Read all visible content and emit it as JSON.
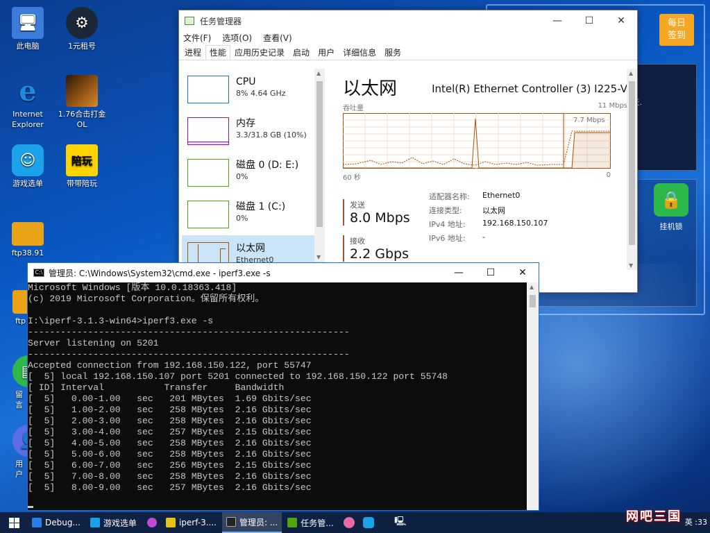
{
  "desktop": {
    "icons": [
      {
        "label": "此电脑",
        "color": "#3b7dd8"
      },
      {
        "label": "1元租号",
        "color": "#1b2838"
      },
      {
        "label": "Internet Explorer",
        "color": "#1e88e5"
      },
      {
        "label": "1.76合击打金 OL",
        "color": "#5a3510"
      },
      {
        "label": "游戏选单",
        "color": "#1aa3e8"
      },
      {
        "label": "带带陪玩",
        "color": "#ffd400"
      },
      {
        "label": "ftp38.91",
        "color": "#e8a317"
      },
      {
        "label": "ftp",
        "color": "#e8a317"
      },
      {
        "label": "留言",
        "color": "#2db84c"
      },
      {
        "label": "用户",
        "color": "#5b6ee8"
      }
    ],
    "glyphs": {
      "steam": "⚙",
      "peiwan": "陪玩"
    }
  },
  "right_panel": {
    "sign_button": "每日\n签到",
    "sign_line1": "每日",
    "sign_line2": "签到",
    "lock_label": "挂机锁",
    "panel_text_fragment": "天."
  },
  "task_manager": {
    "title": "任务管理器",
    "controls": {
      "minimize": "—",
      "maximize": "☐",
      "close": "✕"
    },
    "menu": [
      "文件(F)",
      "选项(O)",
      "查看(V)"
    ],
    "tabs": [
      "进程",
      "性能",
      "应用历史记录",
      "启动",
      "用户",
      "详细信息",
      "服务"
    ],
    "active_tab": "性能",
    "items": [
      {
        "name": "CPU",
        "value": "8% 4.64 GHz",
        "color": "#117dbb"
      },
      {
        "name": "内存",
        "value": "3.3/31.8 GB (10%)",
        "color": "#8b12ae"
      },
      {
        "name": "磁盘 0 (D: E:)",
        "value": "0%",
        "color": "#4da60c"
      },
      {
        "name": "磁盘 1 (C:)",
        "value": "0%",
        "color": "#4da60c"
      },
      {
        "name": "以太网",
        "value": "Ethernet0",
        "color": "#a74f01"
      }
    ],
    "detail": {
      "title": "以太网",
      "adapter": "Intel(R) Ethernet Controller (3) I225-V",
      "throughput_label": "吞吐量",
      "max_label": "11 Mbps",
      "inner_max_label": "7.7 Mbps",
      "time_left": "60 秒",
      "time_right": "0",
      "send_label": "发送",
      "send_value": "8.0 Mbps",
      "recv_label": "接收",
      "recv_value": "2.2 Gbps",
      "props": [
        {
          "key": "适配器名称:",
          "value": "Ethernet0"
        },
        {
          "key": "连接类型:",
          "value": "以太网"
        },
        {
          "key": "IPv4 地址:",
          "value": "192.168.150.107"
        },
        {
          "key": "IPv6 地址:",
          "value": "-"
        }
      ],
      "graph_color": "#a74f01"
    }
  },
  "cmd": {
    "title": "管理员: C:\\Windows\\System32\\cmd.exe - iperf3.exe  -s",
    "controls": {
      "minimize": "—",
      "maximize": "☐",
      "close": "✕"
    },
    "lines": [
      "Microsoft Windows [版本 10.0.18363.418]",
      "(c) 2019 Microsoft Corporation。保留所有权利。",
      "",
      "I:\\iperf-3.1.3-win64>iperf3.exe -s",
      "-----------------------------------------------------------",
      "Server listening on 5201",
      "-----------------------------------------------------------",
      "Accepted connection from 192.168.150.122, port 55747",
      "[  5] local 192.168.150.107 port 5201 connected to 192.168.150.122 port 55748",
      "[ ID] Interval           Transfer     Bandwidth",
      "[  5]   0.00-1.00   sec   201 MBytes  1.69 Gbits/sec",
      "[  5]   1.00-2.00   sec   258 MBytes  2.16 Gbits/sec",
      "[  5]   2.00-3.00   sec   258 MBytes  2.16 Gbits/sec",
      "[  5]   3.00-4.00   sec   257 MBytes  2.15 Gbits/sec",
      "[  5]   4.00-5.00   sec   258 MBytes  2.16 Gbits/sec",
      "[  5]   5.00-6.00   sec   258 MBytes  2.16 Gbits/sec",
      "[  5]   6.00-7.00   sec   256 MBytes  2.15 Gbits/sec",
      "[  5]   7.00-8.00   sec   258 MBytes  2.16 Gbits/sec",
      "[  5]   8.00-9.00   sec   257 MBytes  2.16 Gbits/sec"
    ]
  },
  "taskbar": {
    "items": [
      {
        "label": "Debug...",
        "color": "#2b7de9",
        "active": false
      },
      {
        "label": "游戏选单",
        "color": "#1aa3e8",
        "active": false
      },
      {
        "label": "",
        "color": "#c04ad0",
        "active": false
      },
      {
        "label": "iperf-3....",
        "color": "#e8c317",
        "active": false
      },
      {
        "label": "管理员: ...",
        "color": "#222222",
        "active": true
      },
      {
        "label": "任务管...",
        "color": "#4da60c",
        "active": false
      }
    ],
    "clock_fragment": ":33",
    "watermark": "网吧三国",
    "tray_fragment": "英"
  }
}
